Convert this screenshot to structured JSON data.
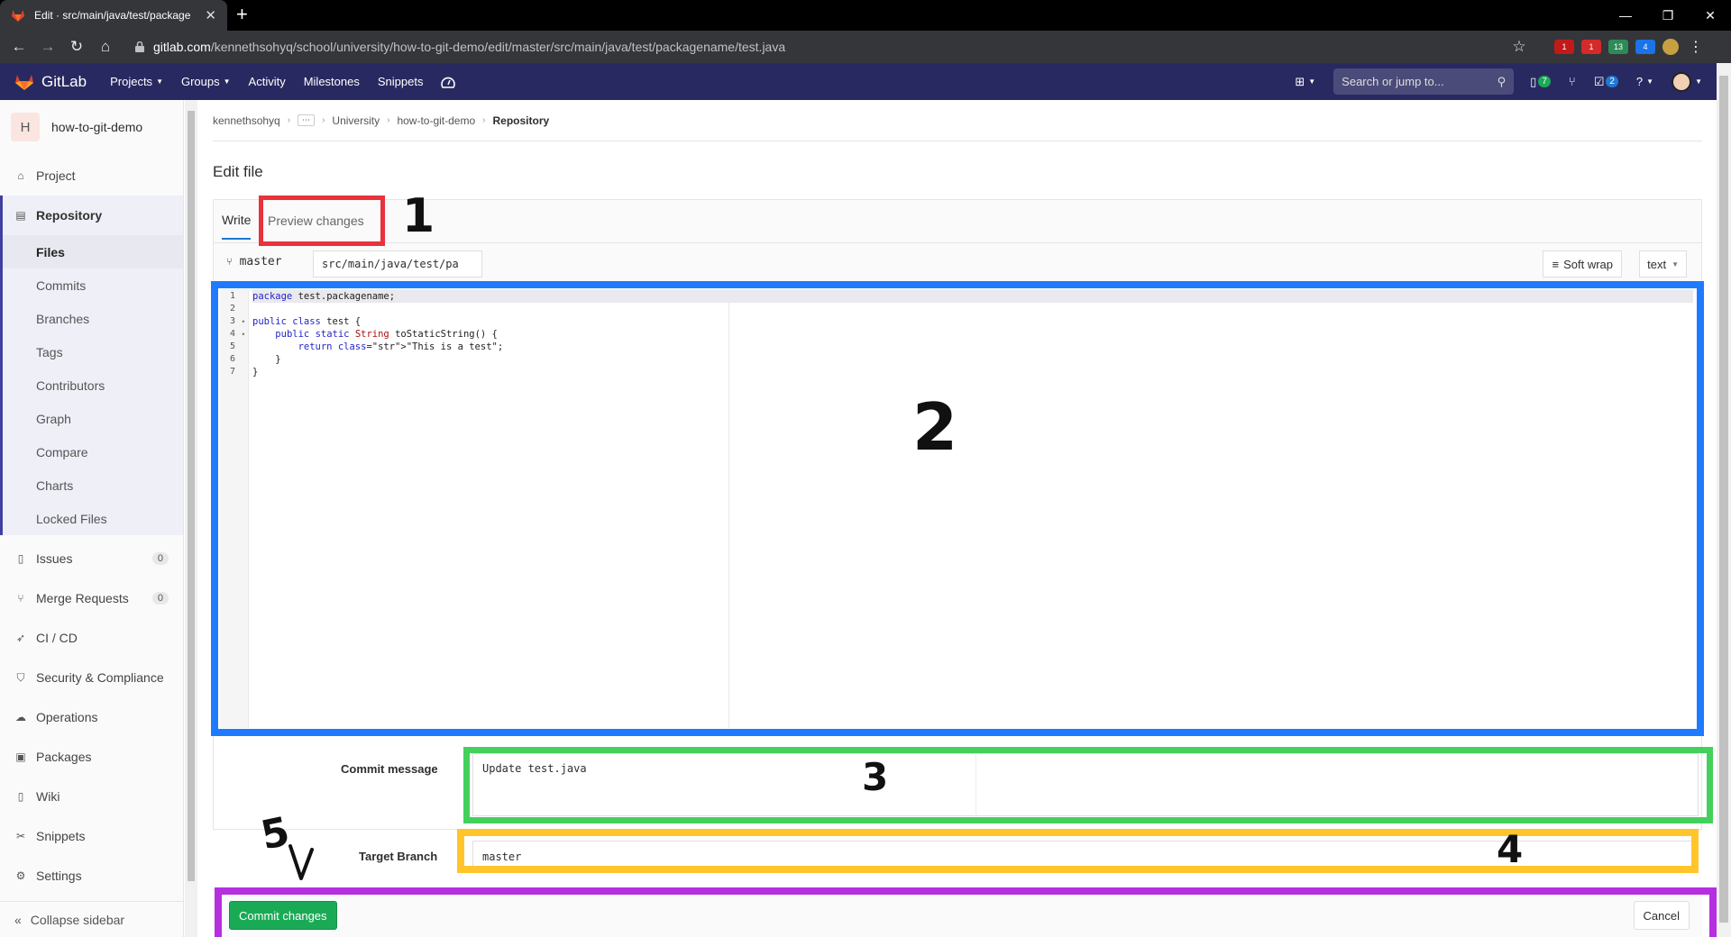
{
  "browser": {
    "tab_title": "Edit · src/main/java/test/package",
    "url_host": "gitlab.com",
    "url_path": "/kennethsohyq/school/university/how-to-git-demo/edit/master/src/main/java/test/packagename/test.java",
    "ext_badges": [
      "1",
      "1",
      "13",
      "4"
    ]
  },
  "navbar": {
    "brand": "GitLab",
    "links": [
      "Projects",
      "Groups",
      "Activity",
      "Milestones",
      "Snippets"
    ],
    "search_placeholder": "Search or jump to...",
    "issues_count": "7",
    "todos_count": "2"
  },
  "sidebar": {
    "project_initial": "H",
    "project_name": "how-to-git-demo",
    "items": {
      "project": "Project",
      "repository": "Repository",
      "sub": [
        "Files",
        "Commits",
        "Branches",
        "Tags",
        "Contributors",
        "Graph",
        "Compare",
        "Charts",
        "Locked Files"
      ],
      "issues": "Issues",
      "issues_count": "0",
      "merge_requests": "Merge Requests",
      "mr_count": "0",
      "cicd": "CI / CD",
      "security": "Security & Compliance",
      "operations": "Operations",
      "packages": "Packages",
      "wiki": "Wiki",
      "snippets": "Snippets",
      "settings": "Settings"
    },
    "collapse_label": "Collapse sidebar"
  },
  "breadcrumb": {
    "user": "kennethsohyq",
    "dots": "⋯",
    "group": "University",
    "project": "how-to-git-demo",
    "current": "Repository"
  },
  "page": {
    "title": "Edit file",
    "tab_write": "Write",
    "tab_preview": "Preview changes",
    "branch": "master",
    "file_path": "src/main/java/test/pa",
    "soft_wrap": "Soft wrap",
    "mode": "text"
  },
  "editor": {
    "lines": [
      {
        "n": "1",
        "fold": "",
        "text": "package test.packagename;"
      },
      {
        "n": "2",
        "fold": "",
        "text": ""
      },
      {
        "n": "3",
        "fold": "▾",
        "text": "public class test {"
      },
      {
        "n": "4",
        "fold": "▾",
        "text": "    public static String toStaticString() {"
      },
      {
        "n": "5",
        "fold": "",
        "text": "        return \"This is a test\";"
      },
      {
        "n": "6",
        "fold": "",
        "text": "    }"
      },
      {
        "n": "7",
        "fold": "",
        "text": "}"
      }
    ]
  },
  "form": {
    "commit_label": "Commit message",
    "commit_message": "Update test.java",
    "target_label": "Target Branch",
    "target_branch": "master",
    "commit_button": "Commit changes",
    "cancel_button": "Cancel"
  },
  "annotations": {
    "n1": "1",
    "n2": "2",
    "n3": "3",
    "n4": "4",
    "n5": "5",
    "colors": {
      "red": "#e8323c",
      "blue": "#1e7bff",
      "green": "#43d15c",
      "yellow": "#ffc52a",
      "purple": "#b52fe0"
    }
  }
}
